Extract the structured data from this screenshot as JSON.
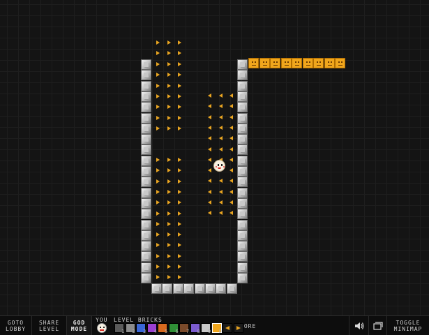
{
  "toolbar": {
    "goto_lobby": [
      "GOTO",
      "LOBBY"
    ],
    "share_level": [
      "SHARE",
      "LEVEL"
    ],
    "god_mode": [
      "GOD",
      "MODE"
    ],
    "you_label": "YOU",
    "level_bricks_label": "LEVEL BRICKS",
    "more_label": "MORE",
    "more_icon": "triangle-up",
    "toggle_minimap": [
      "TOGGLE",
      "MINIMAP"
    ],
    "sound_icon": "speaker-icon",
    "fullscreen_icon": "window-icon",
    "brick_hotkeys": [
      "1",
      "2",
      "3",
      "4",
      "5",
      "6",
      "7",
      "8",
      "9",
      "0"
    ],
    "brick_colors": [
      "#5a5a5a",
      "#8c8c8c",
      "#3a66d6",
      "#9b3fd1",
      "#d86a1f",
      "#2f8f36",
      "#7a4a2a",
      "#7b5bcf",
      "#c9c9c9",
      "#f0a61c",
      "#e9a521",
      "#e9a521"
    ]
  },
  "world": {
    "colors": {
      "background": "#141414",
      "grid": "#1e1e1e",
      "brick": "#cfcfcf",
      "coin": "#f0a61c",
      "arrow": "#e9a521"
    },
    "coin_count_top_row": 9,
    "player": "smiley"
  }
}
